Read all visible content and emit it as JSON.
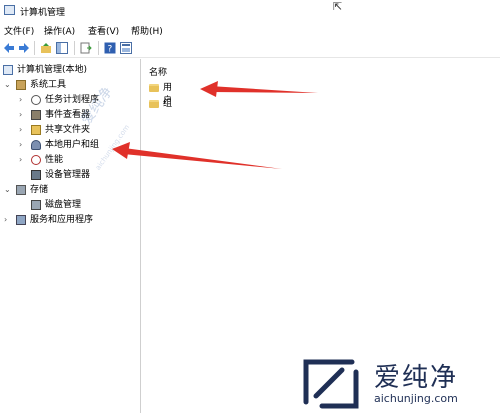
{
  "window": {
    "title": "计算机管理"
  },
  "menu": {
    "file": "文件(F)",
    "action": "操作(A)",
    "view": "查看(V)",
    "help": "帮助(H)"
  },
  "tree": {
    "root": "计算机管理(本地)",
    "system_tools": "系统工具",
    "task_scheduler": "任务计划程序",
    "event_viewer": "事件查看器",
    "shared_folders": "共享文件夹",
    "local_users_groups": "本地用户和组",
    "performance": "性能",
    "device_manager": "设备管理器",
    "storage": "存储",
    "disk_management": "磁盘管理",
    "services_apps": "服务和应用程序"
  },
  "list": {
    "column_name": "名称",
    "items": [
      "用户",
      "组"
    ]
  },
  "watermark": {
    "diag": "爱纯净",
    "diag_url": "aichunjing.com"
  },
  "logo": {
    "text": "爱纯净",
    "url": "aichunjing.com"
  },
  "colors": {
    "arrow": "#e0312a",
    "folder": "#e8c25a",
    "logo": "#1f2f55"
  }
}
